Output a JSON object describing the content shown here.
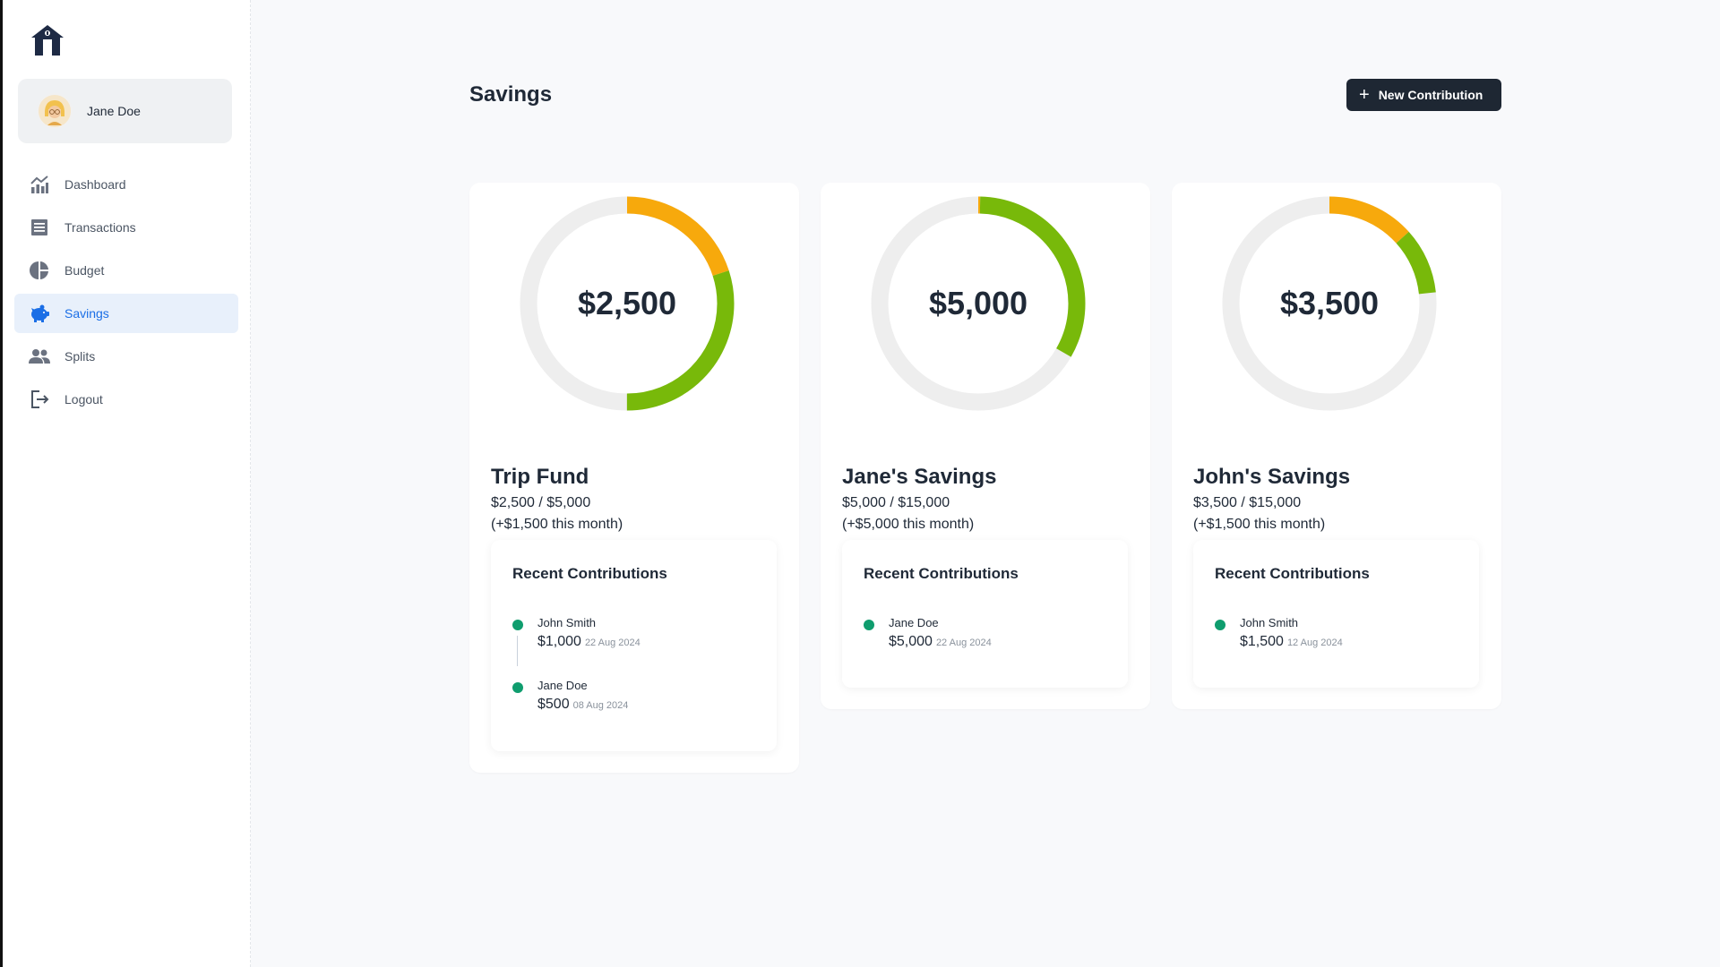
{
  "app": {
    "title": "Savings",
    "new_button_label": "New Contribution",
    "accent_color": "#1a6ee6",
    "primary_button_color": "#1e2733"
  },
  "user": {
    "name": "Jane Doe"
  },
  "sidebar": {
    "items": [
      {
        "label": "Dashboard",
        "icon": "chart-icon",
        "active": false
      },
      {
        "label": "Transactions",
        "icon": "list-icon",
        "active": false
      },
      {
        "label": "Budget",
        "icon": "pie-icon",
        "active": false
      },
      {
        "label": "Savings",
        "icon": "piggy-bank-icon",
        "active": true
      },
      {
        "label": "Splits",
        "icon": "people-icon",
        "active": false
      },
      {
        "label": "Logout",
        "icon": "logout-icon",
        "active": false
      }
    ]
  },
  "colors": {
    "track": "#eeeeee",
    "orange": "#f7a90c",
    "green": "#78b90a",
    "dot": "#0f9d6e"
  },
  "funds": [
    {
      "total": "$2,500",
      "name": "Trip Fund",
      "progress": "$2,500 / $5,000",
      "monthly": "(+$1,500 this month)",
      "recent_title": "Recent Contributions",
      "segments": [
        {
          "color": "orange",
          "fraction": 0.2
        },
        {
          "color": "green",
          "fraction": 0.3
        }
      ],
      "contributions": [
        {
          "name": "John Smith",
          "amount": "$1,000",
          "date": "22 Aug 2024"
        },
        {
          "name": "Jane Doe",
          "amount": "$500",
          "date": "08 Aug 2024"
        }
      ]
    },
    {
      "total": "$5,000",
      "name": "Jane's Savings",
      "progress": "$5,000 / $15,000",
      "monthly": "(+$5,000 this month)",
      "recent_title": "Recent Contributions",
      "segments": [
        {
          "color": "orange",
          "fraction": 0.003
        },
        {
          "color": "green",
          "fraction": 0.33
        }
      ],
      "contributions": [
        {
          "name": "Jane Doe",
          "amount": "$5,000",
          "date": "22 Aug 2024"
        }
      ]
    },
    {
      "total": "$3,500",
      "name": "John's Savings",
      "progress": "$3,500 / $15,000",
      "monthly": "(+$1,500 this month)",
      "recent_title": "Recent Contributions",
      "segments": [
        {
          "color": "orange",
          "fraction": 0.133
        },
        {
          "color": "green",
          "fraction": 0.1
        }
      ],
      "contributions": [
        {
          "name": "John Smith",
          "amount": "$1,500",
          "date": "12 Aug 2024"
        }
      ]
    }
  ]
}
